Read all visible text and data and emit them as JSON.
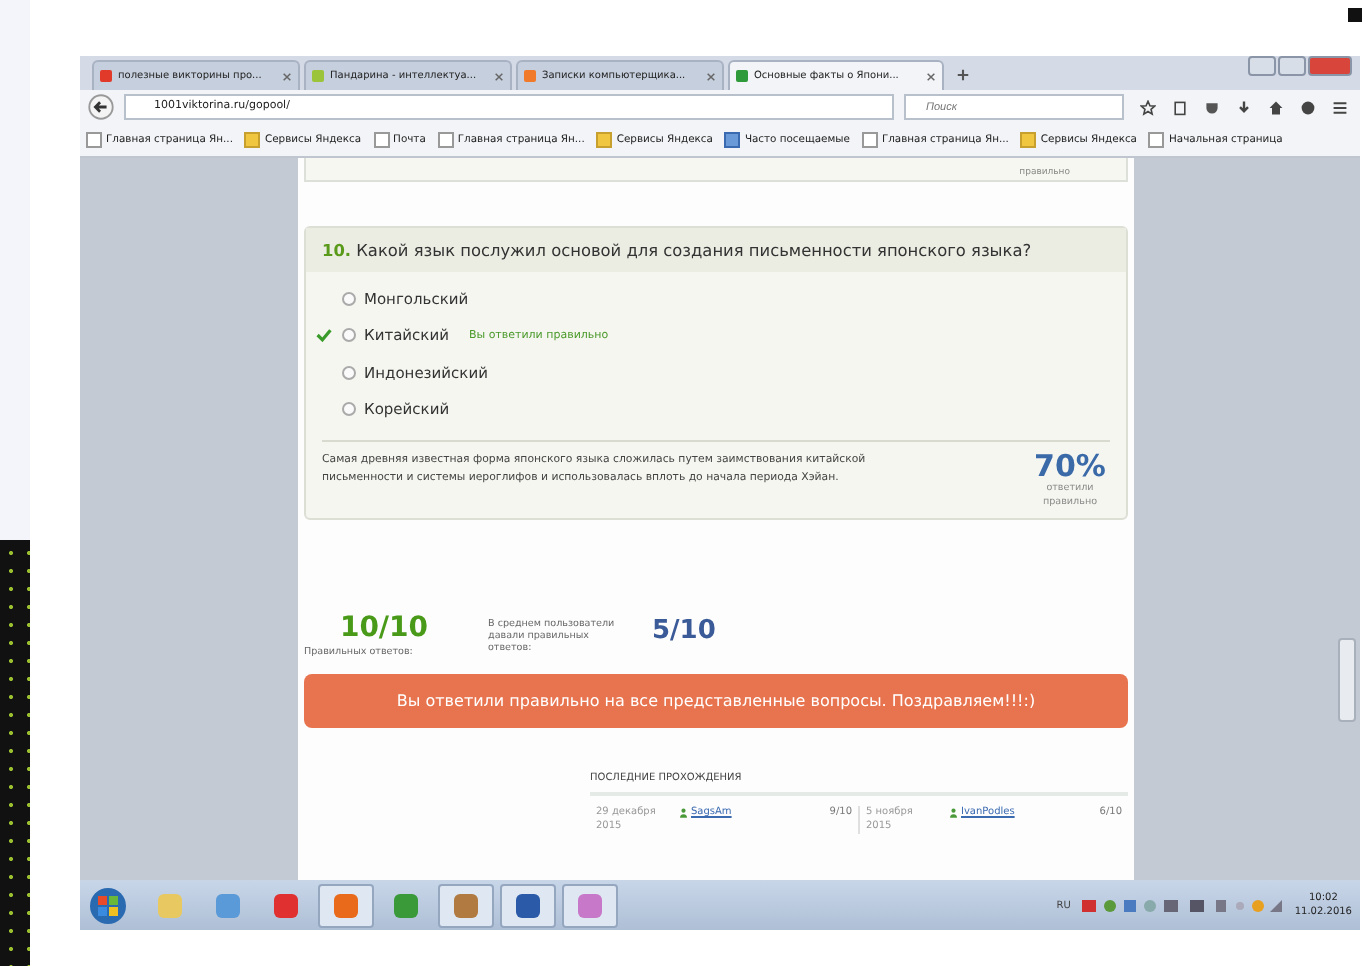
{
  "tabs": [
    {
      "label": "полезные викторины про...",
      "selected": false
    },
    {
      "label": "Пандарина - интеллектуа...",
      "selected": false
    },
    {
      "label": "Записки компьютерщика...",
      "selected": false
    },
    {
      "label": "Основные факты о Япони...",
      "selected": true
    }
  ],
  "address": "1001viktorina.ru/gopool/",
  "search": {
    "placeholder": "Поиск"
  },
  "bookmarks": [
    {
      "label": "Главная страница Ян...",
      "kind": "page"
    },
    {
      "label": "Сервисы Яндекса",
      "kind": "folder"
    },
    {
      "label": "Почта",
      "kind": "page"
    },
    {
      "label": "Главная страница Ян...",
      "kind": "page"
    },
    {
      "label": "Сервисы Яндекса",
      "kind": "folder"
    },
    {
      "label": "Часто посещаемые",
      "kind": "special"
    },
    {
      "label": "Главная страница Ян...",
      "kind": "page"
    },
    {
      "label": "Сервисы Яндекса",
      "kind": "folder"
    },
    {
      "label": "Начальная страница",
      "kind": "page"
    }
  ],
  "prev_card_text": "правильно",
  "question": {
    "number": "10.",
    "text": "Какой язык послужил основой для создания письменности японского языка?",
    "answers": [
      {
        "label": "Монгольский",
        "correct": false,
        "selected": false
      },
      {
        "label": "Китайский",
        "correct": true,
        "selected": false,
        "note": "Вы ответили правильно"
      },
      {
        "label": "Индонезийский",
        "correct": false,
        "selected": false
      },
      {
        "label": "Корейский",
        "correct": false,
        "selected": false
      }
    ],
    "explanation": "Самая древняя известная форма японского языка сложилась путем заимствования китайской письменности и системы иероглифов и использовалась вплоть до начала периода Хэйан.",
    "percent": "70%",
    "percent_label": "ответили правильно"
  },
  "score": {
    "value": "10/10",
    "label": "Правильных ответов:"
  },
  "average": {
    "label": "В среднем пользователи давали правильных ответов:",
    "value": "5/10"
  },
  "banner": "Вы ответили правильно на все представленные вопросы. Поздравляем!!!:)",
  "recent": {
    "title": "ПОСЛЕДНИЕ ПРОХОЖДЕНИЯ",
    "entries": [
      {
        "date": "29 декабря 2015",
        "user": "SagsAm",
        "score": "9/10"
      },
      {
        "date": "5 ноября 2015",
        "user": "IvanPodles",
        "score": "6/10"
      }
    ]
  },
  "taskbar": {
    "apps": [
      {
        "kind": "folder",
        "active": false
      },
      {
        "kind": "speaker",
        "active": false
      },
      {
        "kind": "yandex",
        "active": false
      },
      {
        "kind": "firefox",
        "active": true
      },
      {
        "kind": "chrome",
        "active": false
      },
      {
        "kind": "winamp",
        "active": true
      },
      {
        "kind": "word",
        "active": true
      },
      {
        "kind": "paint",
        "active": true
      }
    ],
    "language": "RU",
    "time": "10:02",
    "date": "11.02.2016"
  }
}
